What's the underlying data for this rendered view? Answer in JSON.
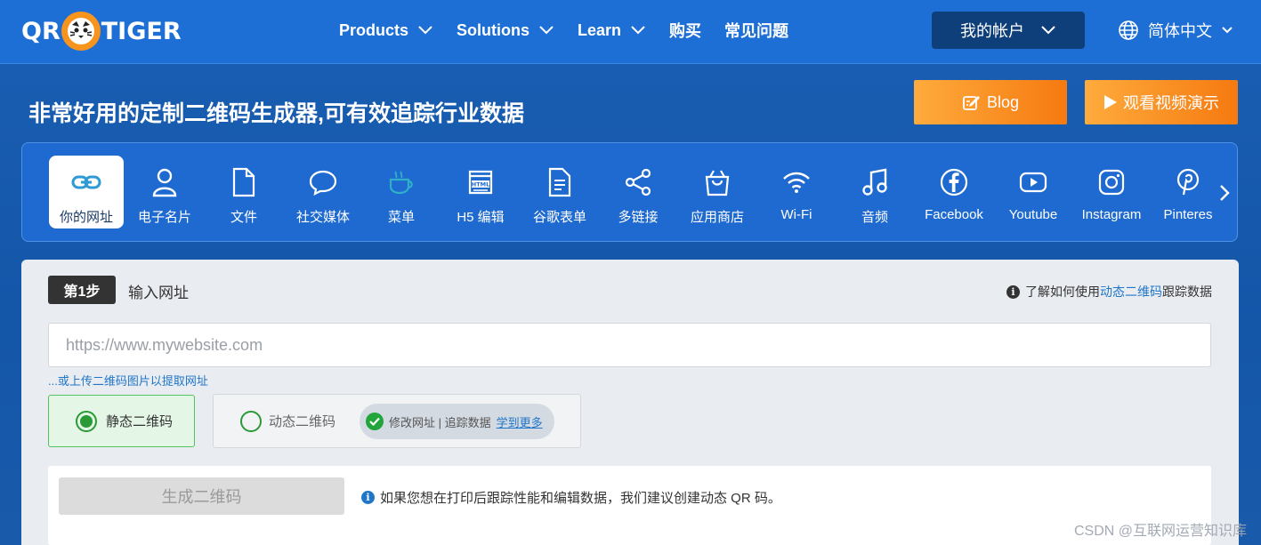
{
  "nav": {
    "logo_left": "QR",
    "logo_right": "TIGER",
    "links": [
      {
        "label": "Products",
        "has_caret": true
      },
      {
        "label": "Solutions",
        "has_caret": true
      },
      {
        "label": "Learn",
        "has_caret": true
      },
      {
        "label": "购买",
        "has_caret": false
      },
      {
        "label": "常见问题",
        "has_caret": false
      }
    ],
    "account_label": "我的帐户",
    "language_label": "简体中文"
  },
  "hero": {
    "title": "非常好用的定制二维码生成器,可有效追踪行业数据",
    "blog_label": "Blog",
    "video_label": "观看视频演示"
  },
  "categories": [
    {
      "label": "你的网址",
      "icon": "link-icon",
      "active": true
    },
    {
      "label": "电子名片",
      "icon": "person-icon",
      "active": false
    },
    {
      "label": "文件",
      "icon": "file-icon",
      "active": false
    },
    {
      "label": "社交媒体",
      "icon": "chat-bubble-icon",
      "active": false
    },
    {
      "label": "菜单",
      "icon": "coffee-cup-icon",
      "active": false
    },
    {
      "label": "H5 编辑",
      "icon": "html-icon",
      "active": false
    },
    {
      "label": "谷歌表单",
      "icon": "form-document-icon",
      "active": false
    },
    {
      "label": "多链接",
      "icon": "share-icon",
      "active": false
    },
    {
      "label": "应用商店",
      "icon": "shopping-bag-icon",
      "active": false
    },
    {
      "label": "Wi-Fi",
      "icon": "wifi-icon",
      "active": false
    },
    {
      "label": "音频",
      "icon": "music-note-icon",
      "active": false
    },
    {
      "label": "Facebook",
      "icon": "facebook-icon",
      "active": false
    },
    {
      "label": "Youtube",
      "icon": "youtube-icon",
      "active": false
    },
    {
      "label": "Instagram",
      "icon": "instagram-icon",
      "active": false
    },
    {
      "label": "Pinteres",
      "icon": "pinterest-icon",
      "active": false
    }
  ],
  "panel": {
    "step_badge": "第1步",
    "step_label": "输入网址",
    "learn_prefix": "了解如何使用",
    "learn_link": "动态二维码",
    "learn_suffix": "跟踪数据",
    "url_placeholder": "https://www.mywebsite.com",
    "url_value": "",
    "upload_link": "...或上传二维码图片以提取网址",
    "static_label": "静态二维码",
    "dynamic_label": "动态二维码",
    "dynamic_features": "修改网址 | 追踪数据",
    "dynamic_more": "学到更多",
    "generate_label": "生成二维码",
    "generate_tip": "如果您想在打印后跟踪性能和编辑数据，我们建议创建动态 QR 码。"
  },
  "colors": {
    "nav_bg": "#1d6fd6",
    "accent_orange": "#f57a10",
    "selected_green": "#2a9a36",
    "link_blue": "#1f76c9"
  },
  "watermark": "CSDN @互联网运营知识库"
}
